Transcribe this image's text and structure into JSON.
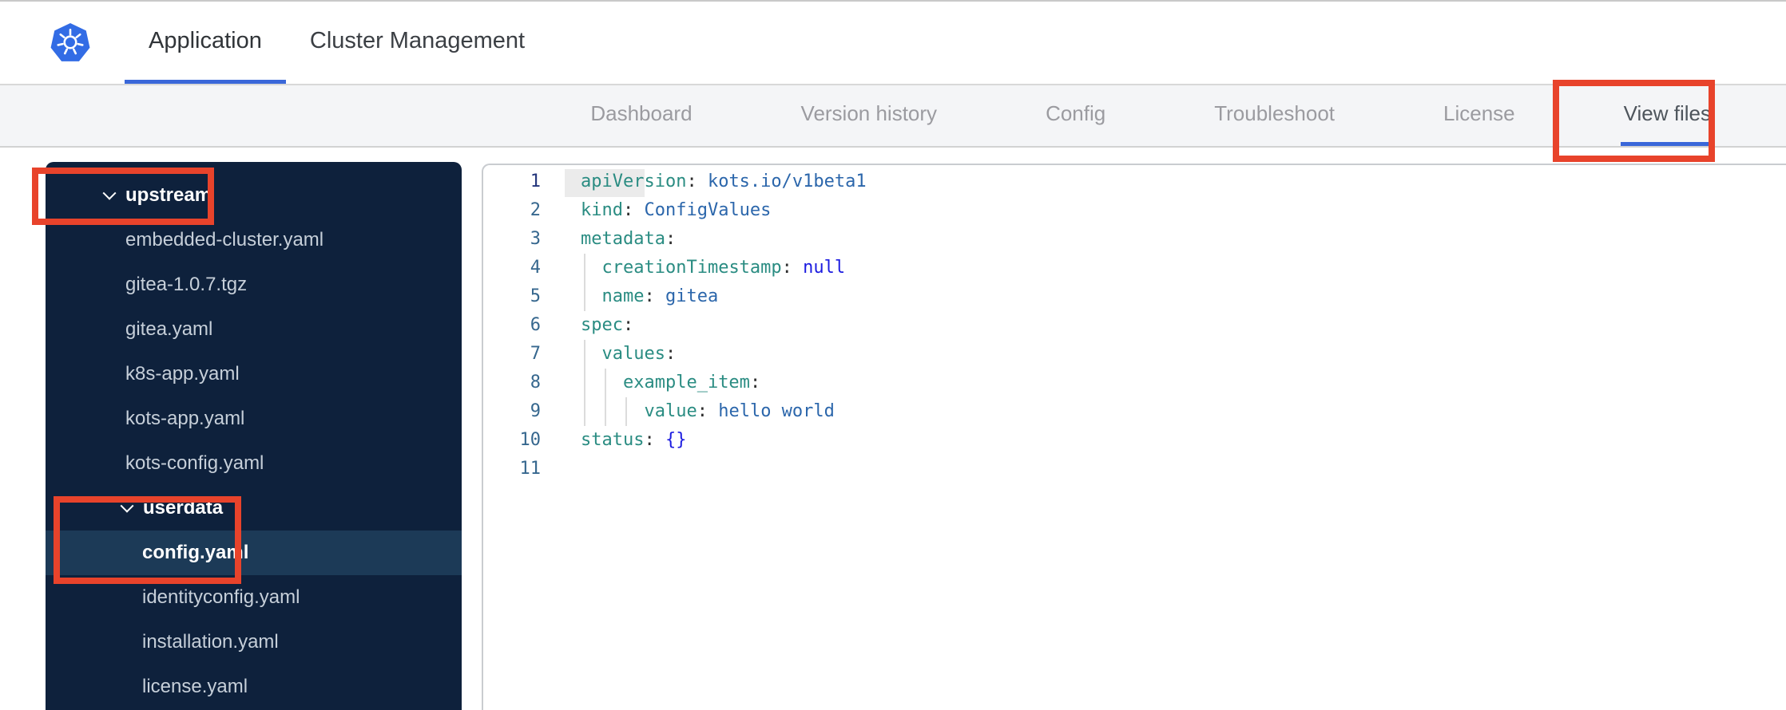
{
  "header": {
    "logo": "kubernetes-logo",
    "tabs": [
      {
        "label": "Application",
        "active": true
      },
      {
        "label": "Cluster Management",
        "active": false
      }
    ]
  },
  "subnav": {
    "tabs": [
      {
        "label": "Dashboard",
        "active": false
      },
      {
        "label": "Version history",
        "active": false
      },
      {
        "label": "Config",
        "active": false
      },
      {
        "label": "Troubleshoot",
        "active": false
      },
      {
        "label": "License",
        "active": false
      },
      {
        "label": "View files",
        "active": true
      }
    ]
  },
  "file_tree": {
    "items": [
      {
        "label": "upstream",
        "type": "folder",
        "level": 0,
        "expanded": true
      },
      {
        "label": "embedded-cluster.yaml",
        "type": "file",
        "level": 1
      },
      {
        "label": "gitea-1.0.7.tgz",
        "type": "file",
        "level": 1
      },
      {
        "label": "gitea.yaml",
        "type": "file",
        "level": 1
      },
      {
        "label": "k8s-app.yaml",
        "type": "file",
        "level": 1
      },
      {
        "label": "kots-app.yaml",
        "type": "file",
        "level": 1
      },
      {
        "label": "kots-config.yaml",
        "type": "file",
        "level": 1
      },
      {
        "label": "userdata",
        "type": "folder",
        "level": 1,
        "expanded": true
      },
      {
        "label": "config.yaml",
        "type": "file",
        "level": 2,
        "selected": true
      },
      {
        "label": "identityconfig.yaml",
        "type": "file",
        "level": 2
      },
      {
        "label": "installation.yaml",
        "type": "file",
        "level": 2
      },
      {
        "label": "license.yaml",
        "type": "file",
        "level": 2
      }
    ]
  },
  "editor": {
    "lines": [
      {
        "num": 1,
        "active": true,
        "tokens": [
          [
            "key",
            "apiVersion"
          ],
          [
            "punct",
            ":"
          ],
          [
            "str",
            " kots.io/v1beta1"
          ]
        ]
      },
      {
        "num": 2,
        "tokens": [
          [
            "key",
            "kind"
          ],
          [
            "punct",
            ":"
          ],
          [
            "str",
            " ConfigValues"
          ]
        ]
      },
      {
        "num": 3,
        "tokens": [
          [
            "key",
            "metadata"
          ],
          [
            "punct",
            ":"
          ]
        ]
      },
      {
        "num": 4,
        "tokens": [
          [
            "str",
            "  "
          ],
          [
            "key",
            "creationTimestamp"
          ],
          [
            "punct",
            ":"
          ],
          [
            "atom",
            " null"
          ]
        ]
      },
      {
        "num": 5,
        "tokens": [
          [
            "str",
            "  "
          ],
          [
            "key",
            "name"
          ],
          [
            "punct",
            ":"
          ],
          [
            "str",
            " gitea"
          ]
        ]
      },
      {
        "num": 6,
        "tokens": [
          [
            "key",
            "spec"
          ],
          [
            "punct",
            ":"
          ]
        ]
      },
      {
        "num": 7,
        "tokens": [
          [
            "str",
            "  "
          ],
          [
            "key",
            "values"
          ],
          [
            "punct",
            ":"
          ]
        ]
      },
      {
        "num": 8,
        "tokens": [
          [
            "str",
            "    "
          ],
          [
            "key",
            "example_item"
          ],
          [
            "punct",
            ":"
          ]
        ]
      },
      {
        "num": 9,
        "tokens": [
          [
            "str",
            "      "
          ],
          [
            "key",
            "value"
          ],
          [
            "punct",
            ":"
          ],
          [
            "str",
            " hello world"
          ]
        ]
      },
      {
        "num": 10,
        "tokens": [
          [
            "key",
            "status"
          ],
          [
            "punct",
            ":"
          ],
          [
            "atom",
            " {}"
          ]
        ]
      },
      {
        "num": 11,
        "tokens": []
      }
    ]
  },
  "annotations": {
    "color": "#e8432b",
    "boxes": [
      "view-files-tab",
      "upstream-folder",
      "userdata-config-selection"
    ]
  },
  "colors": {
    "accent_blue": "#3a67d9",
    "logo_blue": "#326ce5",
    "annotation_red": "#e8432b",
    "sidebar_bg": "#0e213c",
    "sidebar_selected_bg": "#1c3a57",
    "yaml_key_teal": "#2a8c82",
    "yaml_value_blue": "#2b66ab",
    "yaml_atom_blue": "#1c1ce0"
  }
}
